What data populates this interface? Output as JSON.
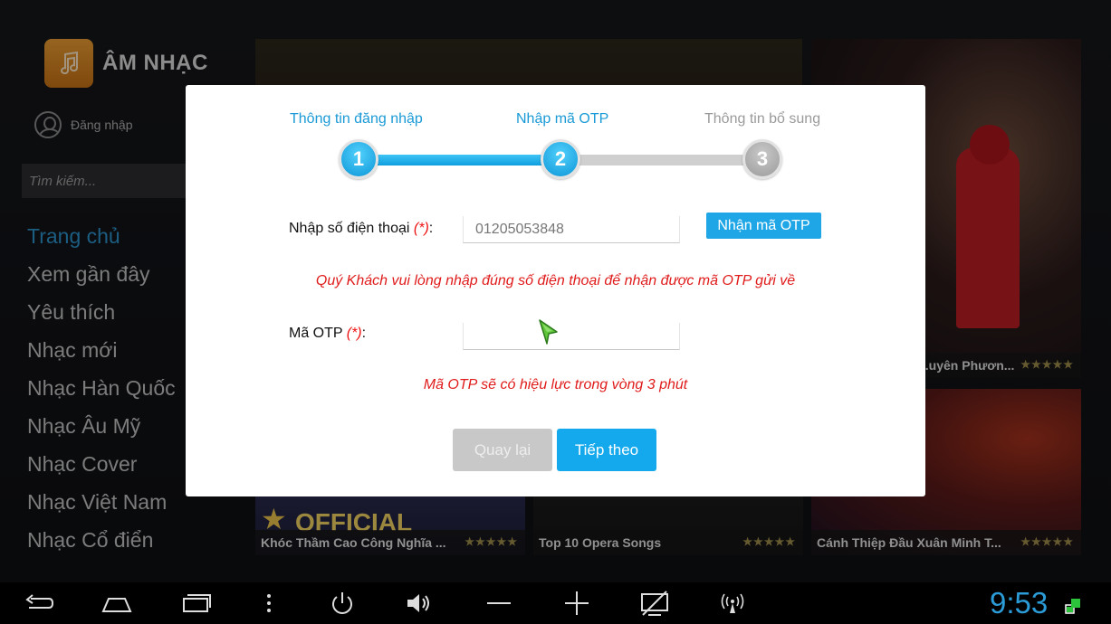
{
  "app": {
    "title": "ÂM NHẠC",
    "logo_icon": "music-note-icon",
    "accent": "#2b8fc8"
  },
  "sidebar": {
    "login_label": "Đăng nhập",
    "search_placeholder": "Tìm kiếm...",
    "items": [
      {
        "label": "Trang chủ",
        "active": true
      },
      {
        "label": "Xem gần đây"
      },
      {
        "label": "Yêu thích"
      },
      {
        "label": "Nhạc mới"
      },
      {
        "label": "Nhạc Hàn Quốc"
      },
      {
        "label": "Nhạc Âu Mỹ"
      },
      {
        "label": "Nhạc Cover"
      },
      {
        "label": "Nhạc Việt Nam"
      },
      {
        "label": "Nhạc Cổ điển"
      }
    ]
  },
  "content": {
    "tiles": [
      {
        "caption": "...uyên Phươn...",
        "stars": "★★★★★"
      },
      {
        "caption": "Khóc Thầm Cao Công Nghĩa ...",
        "stars": "★★★★★",
        "badge": "OFFICIAL"
      },
      {
        "caption": "Top 10 Opera Songs",
        "stars": "★★★★★"
      },
      {
        "caption": "Cánh Thiệp Đầu Xuân Minh T...",
        "stars": "★★★★★"
      }
    ]
  },
  "modal": {
    "steps": [
      {
        "label": "Thông tin đăng nhập",
        "number": "1",
        "state": "done"
      },
      {
        "label": "Nhập mã OTP",
        "number": "2",
        "state": "done"
      },
      {
        "label": "Thông tin bổ sung",
        "number": "3",
        "state": "todo"
      }
    ],
    "progress_percent": 50,
    "phone": {
      "label": "Nhập số điện thoại",
      "required_mark": "(*)",
      "colon": ":",
      "value": "01205053848"
    },
    "get_otp_label": "Nhận mã OTP",
    "phone_hint": "Quý Khách vui lòng nhập đúng số điện thoại để nhận được mã OTP gửi về",
    "otp": {
      "label": "Mã OTP",
      "required_mark": "(*)",
      "colon": ":",
      "value": ""
    },
    "otp_hint": "Mã OTP sẽ có hiệu lực trong vòng 3 phút",
    "back_label": "Quay lại",
    "next_label": "Tiếp theo"
  },
  "navbar": {
    "icons": [
      "back-icon",
      "home-icon",
      "recent-apps-icon",
      "menu-icon",
      "power-icon",
      "volume-icon",
      "volume-down-icon",
      "volume-up-icon",
      "screenshot-icon",
      "wireless-icon"
    ],
    "clock": "9:53"
  }
}
